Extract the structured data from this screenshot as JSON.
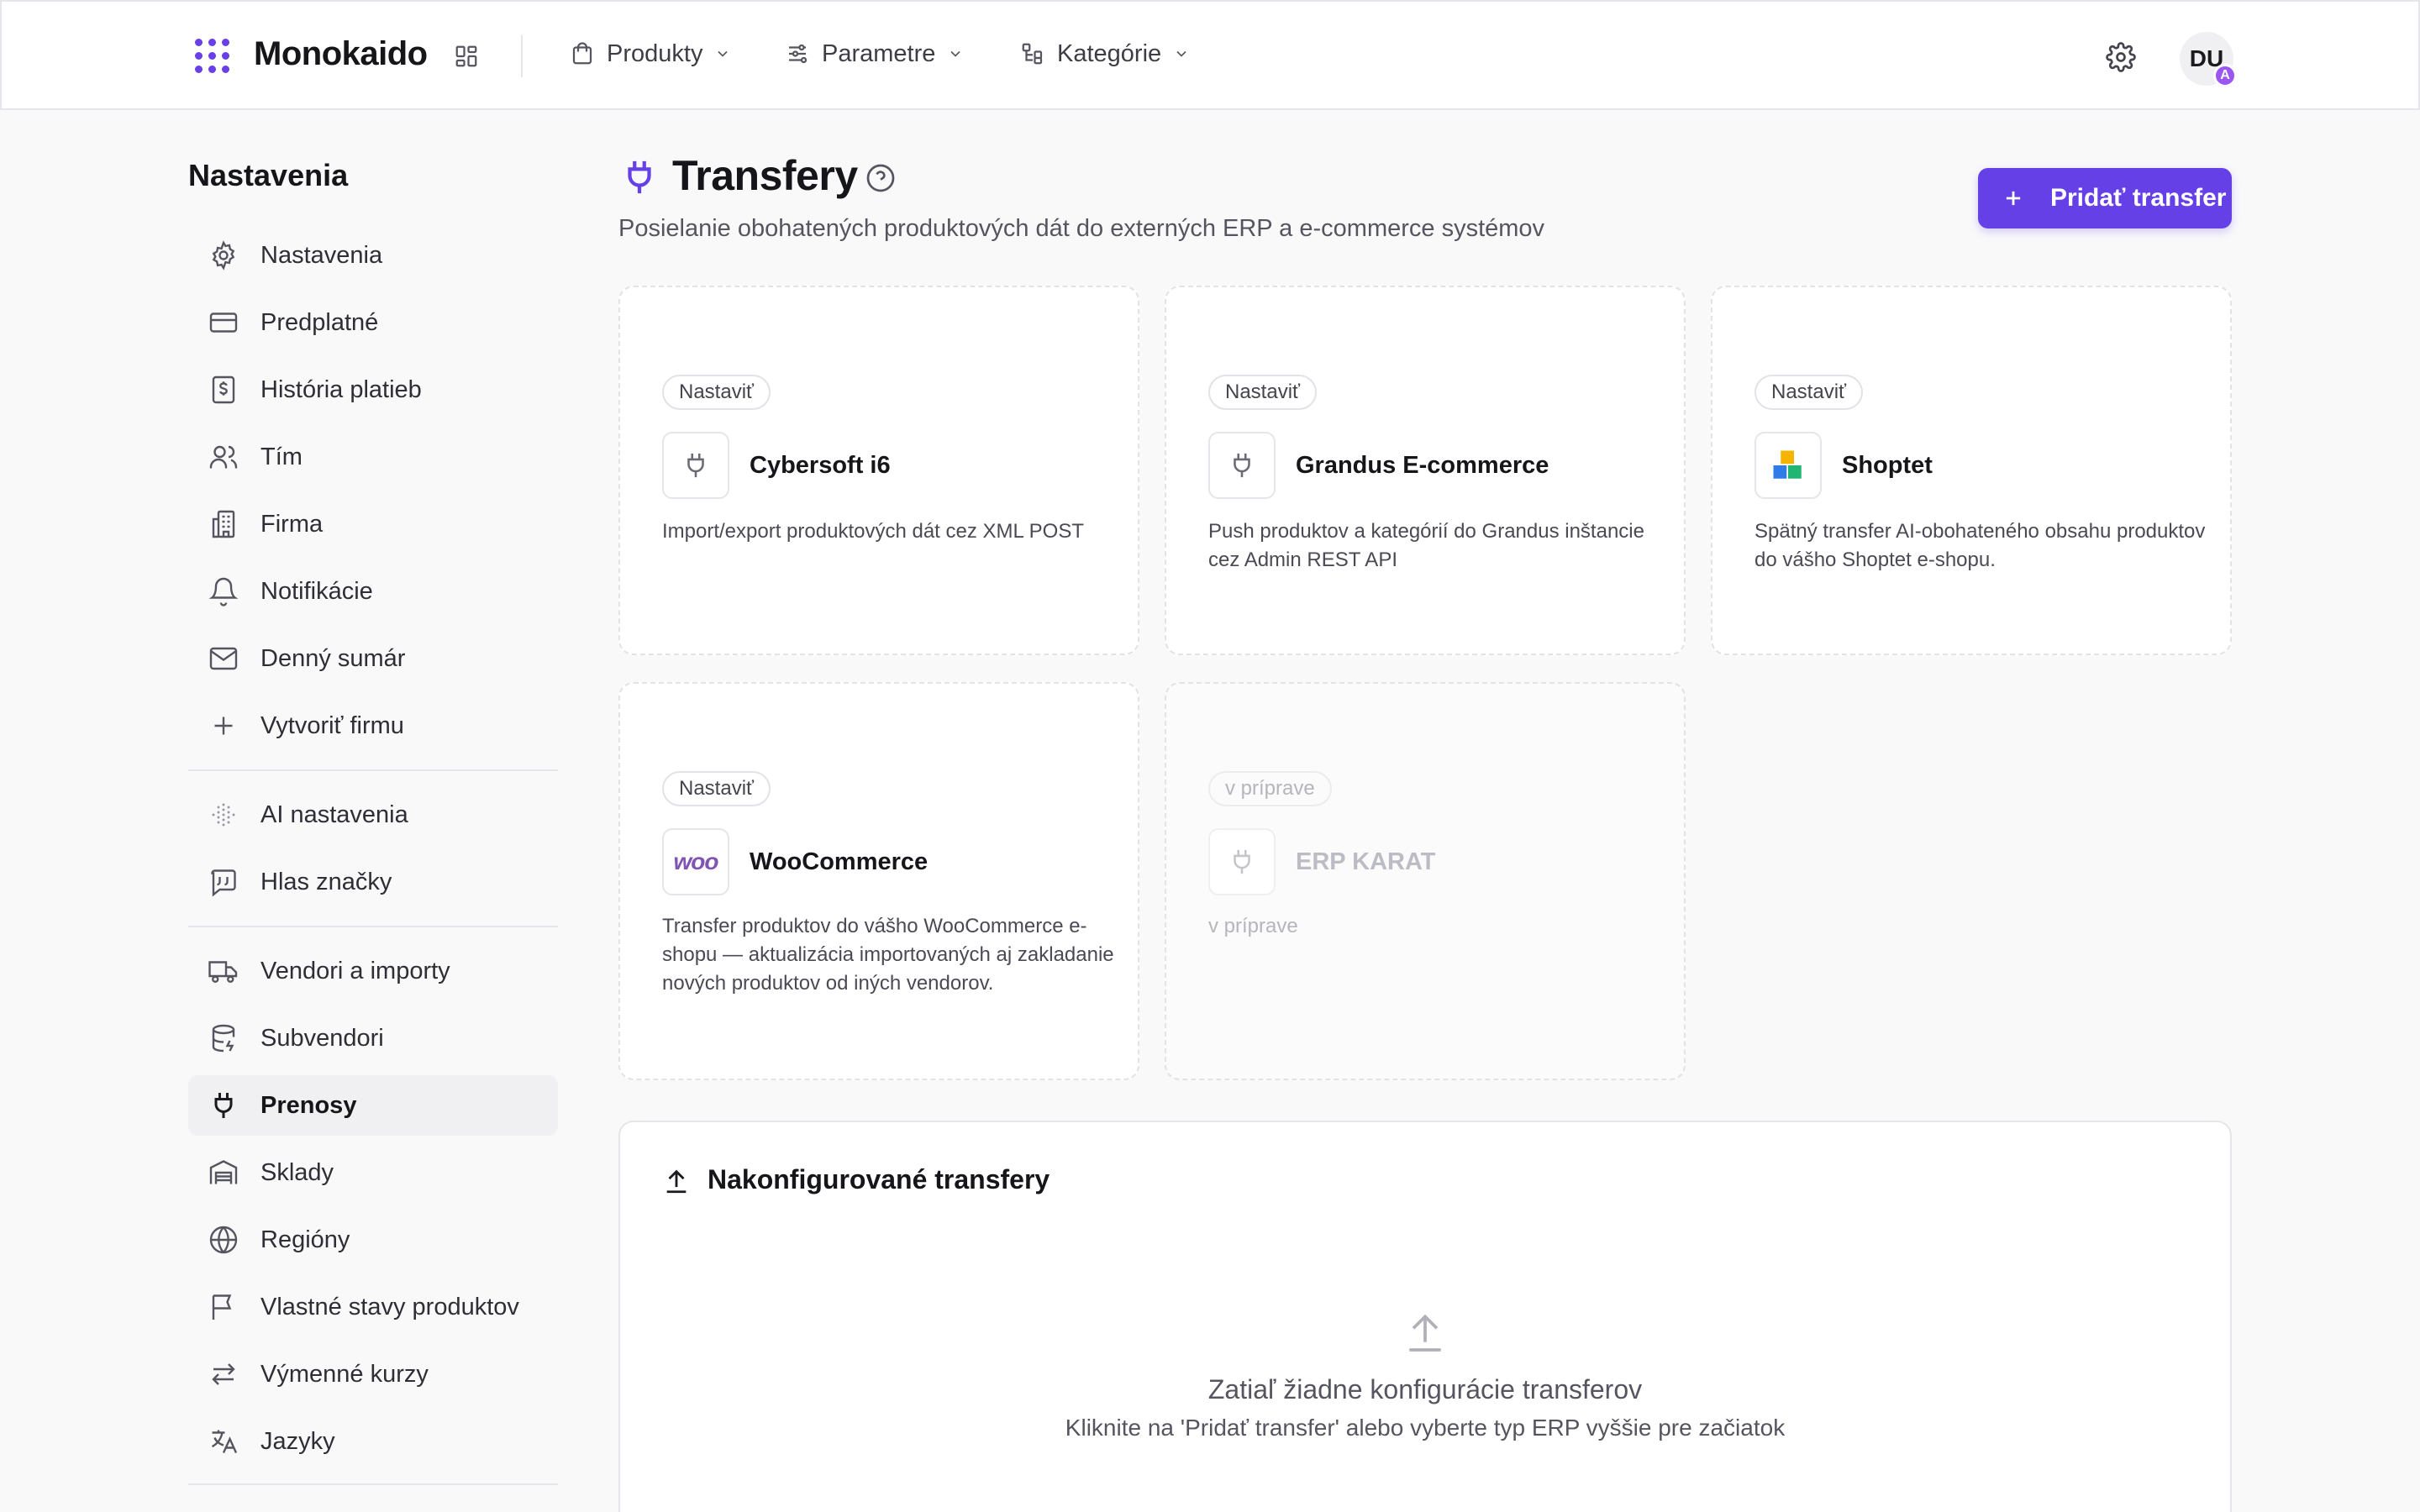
{
  "app": {
    "brand": "Monokaido"
  },
  "topnav": {
    "items": [
      {
        "label": "Produkty",
        "icon": "shopping-bag-icon"
      },
      {
        "label": "Parametre",
        "icon": "sliders-icon"
      },
      {
        "label": "Kategórie",
        "icon": "tree-icon"
      }
    ],
    "avatar_initials": "DU",
    "avatar_badge": "A"
  },
  "sidebar": {
    "title": "Nastavenia",
    "items": [
      {
        "label": "Nastavenia",
        "icon": "gear-icon"
      },
      {
        "label": "Predplatné",
        "icon": "credit-card-icon"
      },
      {
        "label": "História platieb",
        "icon": "receipt-icon"
      },
      {
        "label": "Tím",
        "icon": "users-icon"
      },
      {
        "label": "Firma",
        "icon": "building-icon"
      },
      {
        "label": "Notifikácie",
        "icon": "bell-icon"
      },
      {
        "label": "Denný sumár",
        "icon": "mail-icon"
      },
      {
        "label": "Vytvoriť firmu",
        "icon": "plus-icon"
      },
      {
        "label": "AI nastavenia",
        "icon": "sparkle-dots-icon"
      },
      {
        "label": "Hlas značky",
        "icon": "quote-icon"
      },
      {
        "label": "Vendori a importy",
        "icon": "truck-icon"
      },
      {
        "label": "Subvendori",
        "icon": "database-icon"
      },
      {
        "label": "Prenosy",
        "icon": "plug-icon",
        "active": true
      },
      {
        "label": "Sklady",
        "icon": "warehouse-icon"
      },
      {
        "label": "Regióny",
        "icon": "globe-icon"
      },
      {
        "label": "Vlastné stavy produktov",
        "icon": "flag-icon"
      },
      {
        "label": "Výmenné kurzy",
        "icon": "exchange-icon"
      },
      {
        "label": "Jazyky",
        "icon": "translate-icon"
      }
    ]
  },
  "header": {
    "title": "Transfery",
    "subtitle": "Posielanie obohatených produktových dát do externých ERP a e-commerce systémov",
    "add_button": "Pridať transfer"
  },
  "cards": [
    {
      "badge": "Nastaviť",
      "name": "Cybersoft i6",
      "desc": "Import/export produktových dát cez XML POST",
      "logo": "plug-icon"
    },
    {
      "badge": "Nastaviť",
      "name": "Grandus E-commerce",
      "desc": "Push produktov a kategórií do Grandus inštancie cez Admin REST API",
      "logo": "plug-icon"
    },
    {
      "badge": "Nastaviť",
      "name": "Shoptet",
      "desc": "Spätný transfer AI-obohateného obsahu produktov do vášho Shoptet e-shopu.",
      "logo": "shoptet-logo"
    },
    {
      "badge": "Nastaviť",
      "name": "WooCommerce",
      "desc": "Transfer produktov do vášho WooCommerce e-shopu — aktualizácia importovaných aj zakladanie nových produktov od iných vendorov.",
      "logo": "woo-logo",
      "logo_text": "woo"
    },
    {
      "badge": "v príprave",
      "name": "ERP KARAT",
      "desc": "v príprave",
      "logo": "plug-icon",
      "disabled": true
    }
  ],
  "configured": {
    "title": "Nakonfigurované transfery",
    "empty_title": "Zatiaľ žiadne konfigurácie transferov",
    "empty_sub": "Kliknite na 'Pridať transfer' alebo vyberte typ ERP vyššie pre začiatok"
  },
  "colors": {
    "accent": "#6440e6",
    "badge": "#9b55f0"
  }
}
